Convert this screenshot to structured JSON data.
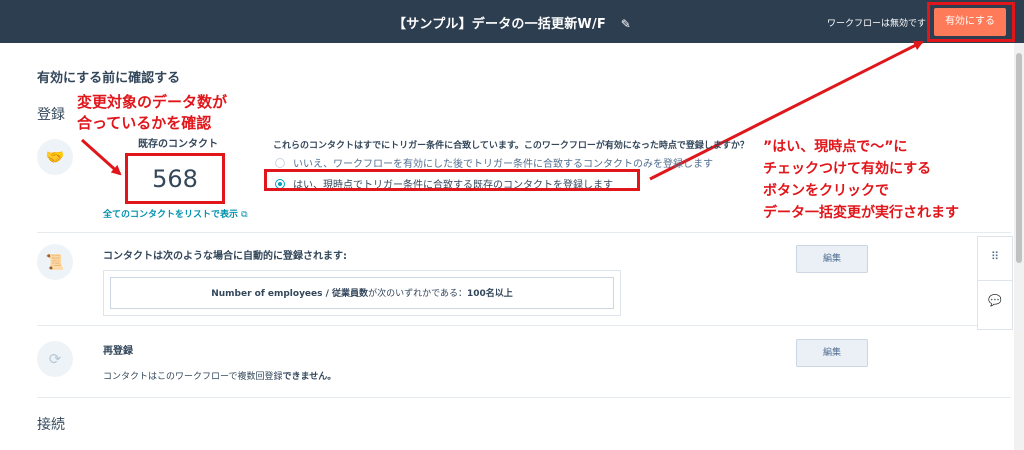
{
  "header": {
    "title": "【サンプル】データの一括更新W/F",
    "edit_icon": "pencil-icon",
    "status_text": "ワークフローは無効です",
    "activate_label": "有効にする"
  },
  "page": {
    "confirm_heading": "有効にする前に確認する",
    "enroll_label": "登録",
    "existing_contacts_label": "既存のコンタクト",
    "existing_contacts_count": "568",
    "view_all_link": "全てのコンタクトをリストで表示",
    "question": "これらのコンタクトはすでにトリガー条件に合致しています。このワークフローが有効になった時点で登録しますか？",
    "option_no": "いいえ、ワークフローを有効にした後でトリガー条件に合致するコンタクトのみを登録します",
    "option_yes": "はい、現時点でトリガー条件に合致する既存のコンタクトを登録します",
    "auto_enroll_title": "コンタクトは次のような場合に自動的に登録されます:",
    "edit_label": "編集",
    "criteria_prop": "Number of employees / 従業員数",
    "criteria_mid": "が次のいずれかである：",
    "criteria_value": "100名以上",
    "reenroll_title": "再登録",
    "reenroll_text_prefix": "コンタクトはこのワークフローで複数回登録",
    "reenroll_text_bold": "できません。",
    "connect_label": "接続"
  },
  "annotations": {
    "left_line1": "変更対象のデータ数が",
    "left_line2": "合っているかを確認",
    "right_line1": "”はい、現時点で～”に",
    "right_line2": "チェックつけて有効にする",
    "right_line3": "ボタンをクリックで",
    "right_line4": "データ一括変更が実行されます"
  },
  "colors": {
    "header_bg": "#2d3e50",
    "accent": "#ff7a59",
    "annotation_red": "#e0161b",
    "link": "#0091ae"
  }
}
